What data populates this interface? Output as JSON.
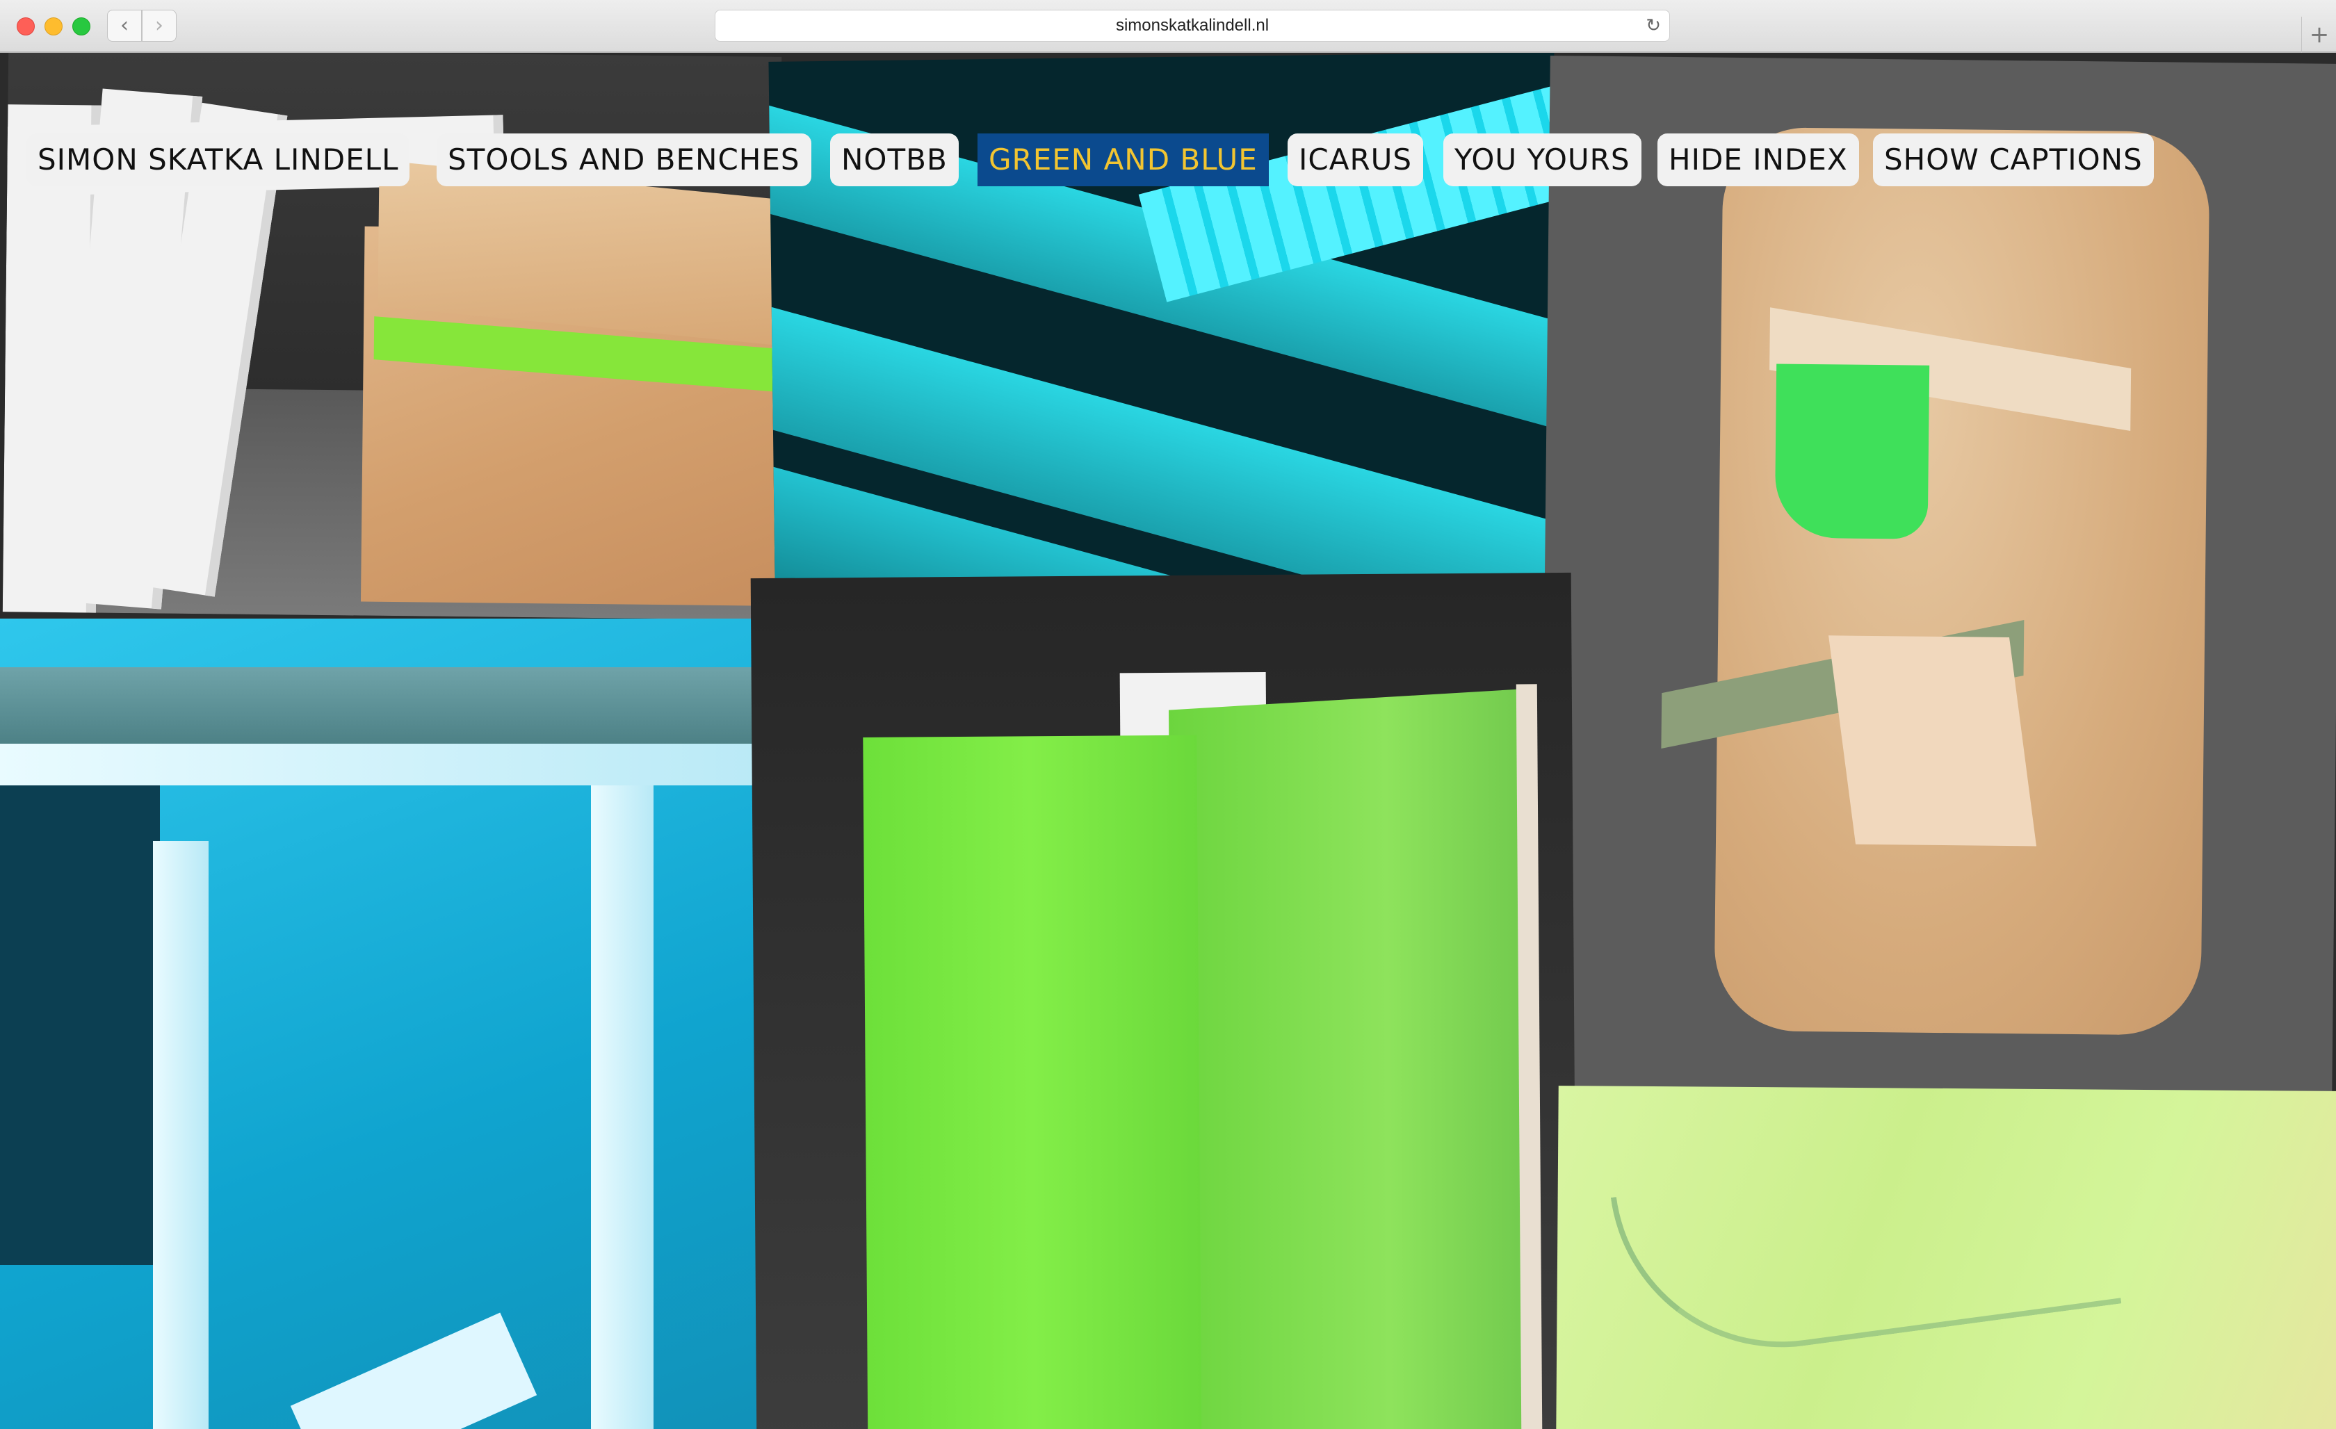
{
  "browser": {
    "url": "simonskatkalindell.nl",
    "back_glyph": "‹",
    "forward_glyph": "›",
    "reload_glyph": "↻",
    "new_tab_glyph": "+"
  },
  "nav": {
    "items": [
      {
        "label": "SIMON SKATKA LINDELL",
        "active": false
      },
      {
        "label": "STOOLS AND BENCHES",
        "active": false
      },
      {
        "label": "NOTBB",
        "active": false
      },
      {
        "label": "GREEN AND BLUE",
        "active": true
      },
      {
        "label": "ICARUS",
        "active": false
      },
      {
        "label": "YOU YOURS",
        "active": false
      },
      {
        "label": "HIDE INDEX",
        "active": false
      },
      {
        "label": "SHOW CAPTIONS",
        "active": false
      }
    ],
    "active_bg": "#0b4a8e",
    "active_fg": "#f2c531"
  },
  "icons": {
    "back": "chevron-left-icon",
    "forward": "chevron-right-icon",
    "reload": "reload-icon",
    "new_tab": "plus-icon"
  }
}
